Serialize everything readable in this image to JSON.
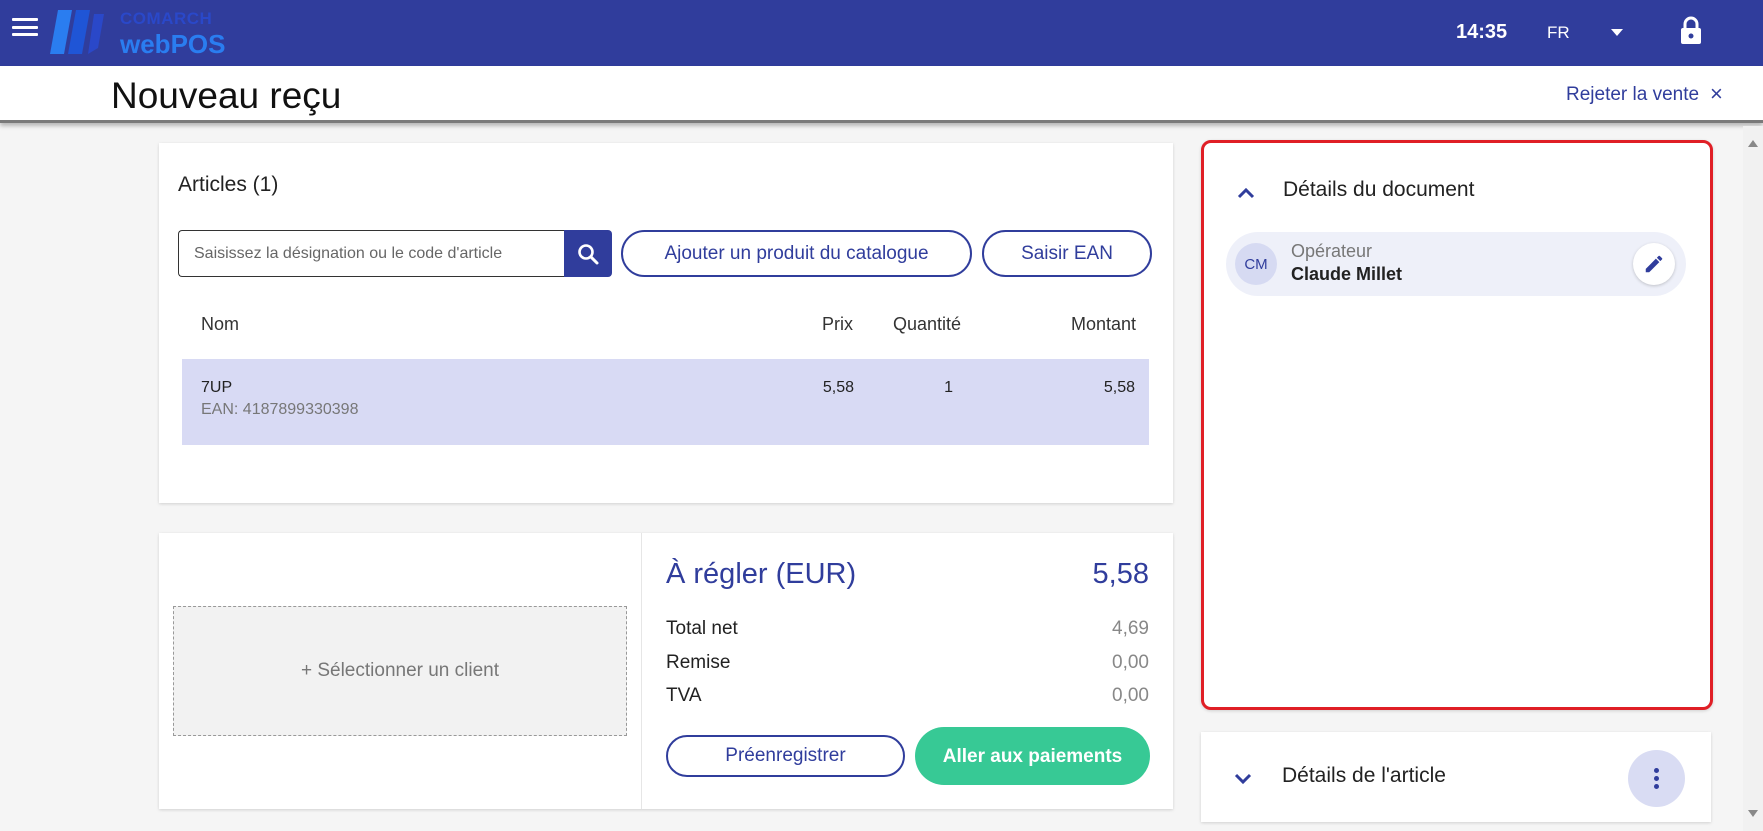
{
  "app": {
    "brand_top": "COMARCH",
    "brand_bottom": "webPOS",
    "time": "14:35",
    "language": "FR"
  },
  "colors": {
    "primary": "#303d9c",
    "accent_green": "#37c995",
    "selected_row": "#d8daf4",
    "highlight_border": "#e01f26"
  },
  "icons": {
    "menu": "hamburger-menu-icon",
    "language_dropdown": "caret-down-icon",
    "lock": "lock-icon",
    "search": "search-icon",
    "close": "close-icon",
    "collapse": "chevron-up-icon",
    "expand": "chevron-down-icon",
    "edit": "pencil-icon",
    "more": "more-vertical-icon"
  },
  "header": {
    "title": "Nouveau reçu",
    "reject_label": "Rejeter la vente",
    "reject_icon": "×"
  },
  "articles": {
    "title": "Articles (1)",
    "search_placeholder": "Saisissez la désignation ou le code d'article",
    "add_catalog_label": "Ajouter un produit du catalogue",
    "enter_ean_label": "Saisir EAN",
    "columns": {
      "name": "Nom",
      "price": "Prix",
      "quantity": "Quantité",
      "amount": "Montant"
    },
    "rows": [
      {
        "name": "7UP",
        "ean": "EAN: 4187899330398",
        "price": "5,58",
        "quantity": "1",
        "amount": "5,58"
      }
    ]
  },
  "summary": {
    "select_client_label": "+ Sélectionner un client",
    "to_pay_label": "À régler (EUR)",
    "to_pay_value": "5,58",
    "net_label": "Total net",
    "net_value": "4,69",
    "discount_label": "Remise",
    "discount_value": "0,00",
    "vat_label": "TVA",
    "vat_value": "0,00",
    "preregister_label": "Préenregistrer",
    "payments_label": "Aller aux paiements"
  },
  "document_details": {
    "title": "Détails du document",
    "operator_initials": "CM",
    "operator_label": "Opérateur",
    "operator_name": "Claude Millet"
  },
  "article_details": {
    "title": "Détails de l'article"
  }
}
